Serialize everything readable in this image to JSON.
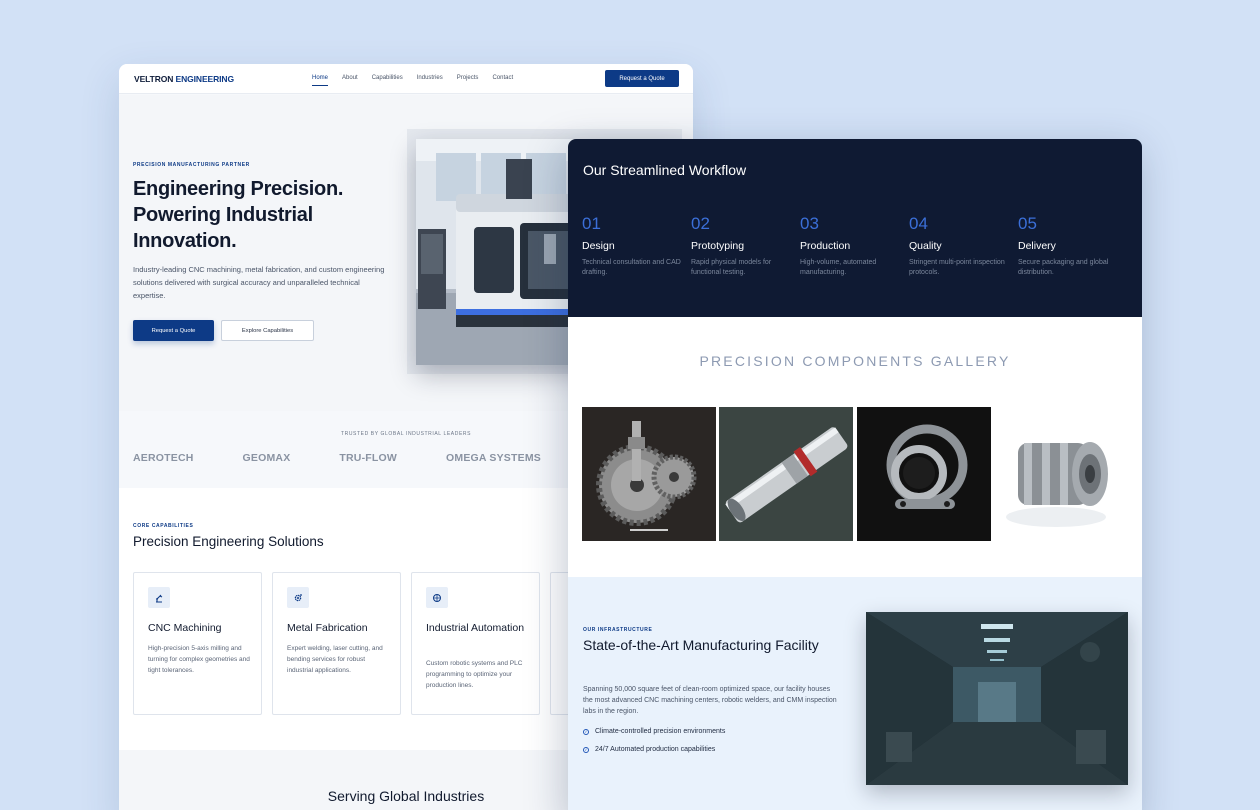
{
  "left_page": {
    "brand": {
      "part1": "VELTRON",
      "part2": " ENGINEERING"
    },
    "nav": {
      "links": [
        "Home",
        "About",
        "Capabilities",
        "Industries",
        "Projects",
        "Contact"
      ],
      "active": "Home",
      "cta": "Request a Quote"
    },
    "hero": {
      "eyebrow": "PRECISION MANUFACTURING PARTNER",
      "title": "Engineering Precision. Powering Industrial Innovation.",
      "description": "Industry-leading CNC machining, metal fabrication, and custom engineering solutions delivered with surgical accuracy and unparalleled technical expertise.",
      "primary_button": "Request a Quote",
      "secondary_button": "Explore Capabilities"
    },
    "trusted": {
      "label": "TRUSTED BY GLOBAL INDUSTRIAL LEADERS",
      "logos": [
        "AEROTECH",
        "GEOMAX",
        "TRU-FLOW",
        "OMEGA SYSTEMS"
      ]
    },
    "capabilities": {
      "eyebrow": "CORE CAPABILITIES",
      "title": "Precision Engineering Solutions",
      "cards": [
        {
          "icon": "robot-arm-icon",
          "title": "CNC Machining",
          "description": "High-precision 5-axis milling and turning for complex geometries and tight tolerances."
        },
        {
          "icon": "gear-icon",
          "title": "Metal Fabrication",
          "description": "Expert welding, laser cutting, and bending services for robust industrial applications."
        },
        {
          "icon": "globe-icon",
          "title": "Industrial Automation",
          "description": "Custom robotic systems and PLC programming to optimize your production lines."
        },
        {
          "icon": "",
          "title": "",
          "description": ""
        }
      ]
    },
    "industries": {
      "title": "Serving Global Industries"
    }
  },
  "right_page": {
    "workflow": {
      "title": "Our Streamlined Workflow",
      "steps": [
        {
          "num": "01",
          "title": "Design",
          "description": "Technical consultation and CAD drafting."
        },
        {
          "num": "02",
          "title": "Prototyping",
          "description": "Rapid physical models for functional testing."
        },
        {
          "num": "03",
          "title": "Production",
          "description": "High-volume, automated manufacturing."
        },
        {
          "num": "04",
          "title": "Quality",
          "description": "Stringent multi-point inspection protocols."
        },
        {
          "num": "05",
          "title": "Delivery",
          "description": "Secure packaging and global distribution."
        }
      ]
    },
    "gallery": {
      "title": "PRECISION COMPONENTS GALLERY",
      "images": [
        "gears-image",
        "shaft-image",
        "bearing-image",
        "coupling-image"
      ]
    },
    "infrastructure": {
      "eyebrow": "OUR INFRASTRUCTURE",
      "title": "State-of-the-Art Manufacturing Facility",
      "description": "Spanning 50,000 square feet of clean-room optimized space, our facility houses the most advanced CNC machining centers, robotic welders, and CMM inspection labs in the region.",
      "checks": [
        "Climate-controlled precision environments",
        "24/7 Automated production capabilities"
      ]
    }
  },
  "colors": {
    "background": "#d2e1f6",
    "brand_navy": "#0d3a86",
    "dark_section": "#0f1a33",
    "step_number_blue": "#3b6fd8"
  }
}
